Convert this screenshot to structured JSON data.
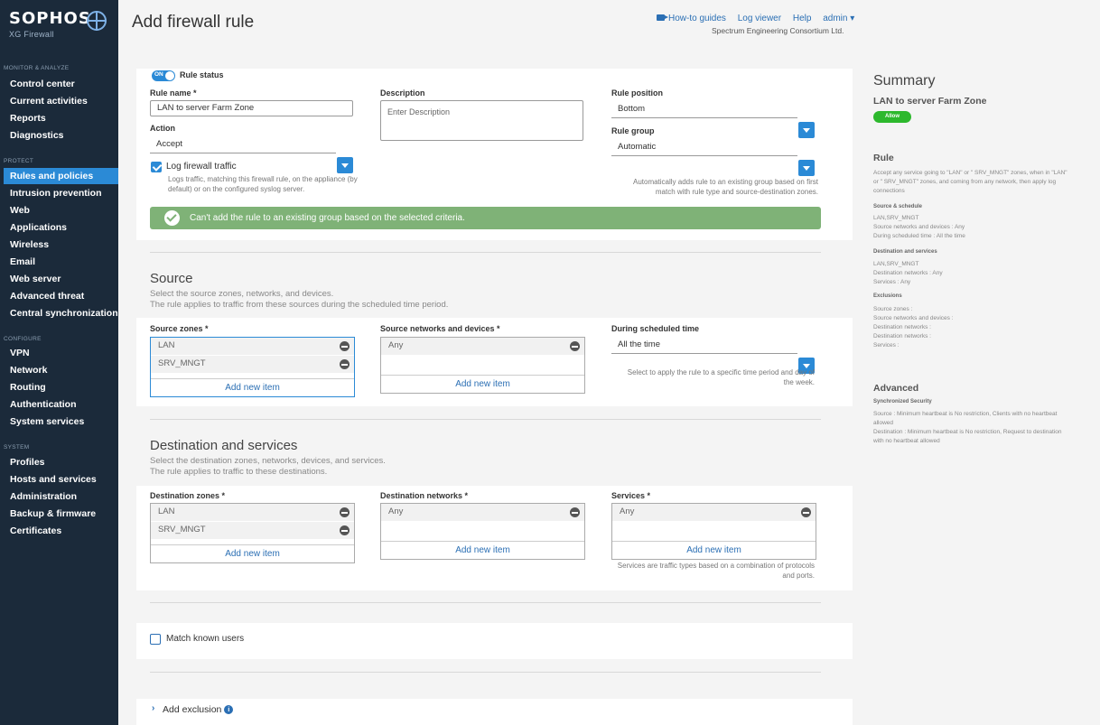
{
  "brand": {
    "name": "SOPHOS",
    "product": "XG Firewall"
  },
  "nav": {
    "monitor_title": "MONITOR & ANALYZE",
    "monitor": [
      "Control center",
      "Current activities",
      "Reports",
      "Diagnostics"
    ],
    "protect_title": "PROTECT",
    "protect": [
      "Rules and policies",
      "Intrusion prevention",
      "Web",
      "Applications",
      "Wireless",
      "Email",
      "Web server",
      "Advanced threat",
      "Central synchronization"
    ],
    "configure_title": "CONFIGURE",
    "configure": [
      "VPN",
      "Network",
      "Routing",
      "Authentication",
      "System services"
    ],
    "system_title": "SYSTEM",
    "system": [
      "Profiles",
      "Hosts and services",
      "Administration",
      "Backup & firmware",
      "Certificates"
    ],
    "active_item": "Rules and policies"
  },
  "header": {
    "title": "Add firewall rule",
    "howto": "How-to guides",
    "logviewer": "Log viewer",
    "help": "Help",
    "admin": "admin ▾",
    "org": "Spectrum Engineering Consortium Ltd."
  },
  "rule": {
    "status_toggle": "ON",
    "status_label": "Rule status",
    "name_label": "Rule name *",
    "name_value": "LAN to  server Farm Zone",
    "description_label": "Description",
    "description_placeholder": "Enter Description",
    "position_label": "Rule position",
    "position_value": "Bottom",
    "action_label": "Action",
    "action_value": "Accept",
    "group_label": "Rule group",
    "group_value": "Automatic",
    "log_label": "Log firewall traffic",
    "log_checked": true,
    "log_help": "Logs traffic, matching this firewall rule, on the appliance (by default) or on the configured syslog server.",
    "group_help": "Automatically adds rule to an existing group based on first match with rule type and source-destination zones.",
    "banner": "Can't add the rule to an existing group based on the selected criteria."
  },
  "source": {
    "title": "Source",
    "desc1": "Select the source zones, networks, and devices.",
    "desc2": "The rule applies to traffic from these sources during the scheduled time period.",
    "zones_label": "Source zones *",
    "zones": [
      "LAN",
      "SRV_MNGT"
    ],
    "networks_label": "Source networks and devices *",
    "networks": [
      "Any"
    ],
    "schedule_label": "During scheduled time",
    "schedule_value": "All the time",
    "schedule_help": "Select to apply the rule to a specific time period and day of the week.",
    "add_new": "Add new item"
  },
  "destination": {
    "title": "Destination and services",
    "desc1": "Select the destination zones, networks, devices, and services.",
    "desc2": "The rule applies to traffic to these destinations.",
    "zones_label": "Destination zones *",
    "zones": [
      "LAN",
      "SRV_MNGT"
    ],
    "networks_label": "Destination networks *",
    "networks": [
      "Any"
    ],
    "services_label": "Services *",
    "services": [
      "Any"
    ],
    "services_help": "Services are traffic types based on a combination of protocols and ports.",
    "add_new": "Add new item"
  },
  "match_users": {
    "label": "Match known users",
    "checked": false
  },
  "exclusion": {
    "label": "Add exclusion",
    "info": "i"
  },
  "summary": {
    "title": "Summary",
    "rule_name": "LAN to server Farm Zone",
    "badge": "Allow",
    "rule_h": "Rule",
    "rule_text": "Accept any service going to \"LAN\" or \" SRV_MNGT\" zones, when in \"LAN\" or \" SRV_MNGT\" zones, and coming from any network, then apply log connections",
    "src_h": "Source & schedule",
    "src_lines": [
      "LAN,SRV_MNGT",
      "Source networks and devices : Any",
      "During scheduled time : All the time"
    ],
    "dst_h": "Destination and services",
    "dst_lines": [
      "LAN,SRV_MNGT",
      "Destination networks : Any",
      "Services : Any"
    ],
    "exc_h": "Exclusions",
    "exc_lines": [
      "Source zones :",
      "Source networks and devices :",
      "Destination networks :",
      "Destination networks :",
      "Services :"
    ],
    "adv_h": "Advanced",
    "sync_h": "Synchronized Security",
    "sync_text1": "Source : Minimum heartbeat is No restriction, Clients with no heartbeat allowed",
    "sync_text2": "Destination : Minimum heartbeat is No restriction, Request to destination with no heartbeat allowed"
  },
  "colors": {
    "sidebar": "#1b2a3a",
    "accent": "#2b8ad6",
    "banner": "#7fb277",
    "allow": "#2db82d"
  }
}
